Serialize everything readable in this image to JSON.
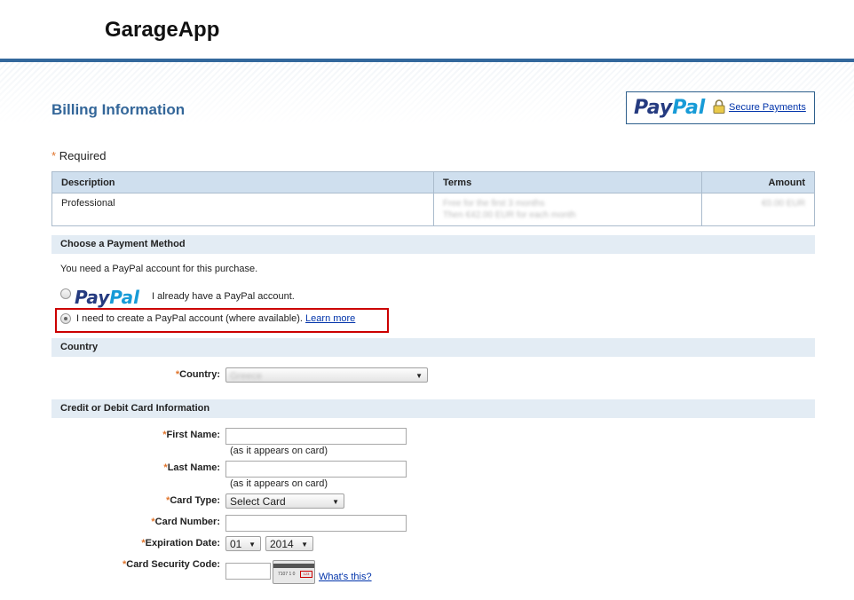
{
  "header": {
    "app_title": "GarageApp"
  },
  "billing": {
    "title": "Billing Information"
  },
  "paypal_badge": {
    "logo_pay": "Pay",
    "logo_pal": "Pal",
    "secure_link": "Secure Payments"
  },
  "required_note": {
    "star": "*",
    "text": "Required"
  },
  "order_table": {
    "headers": {
      "description": "Description",
      "terms": "Terms",
      "amount": "Amount"
    },
    "row": {
      "description": "Professional",
      "terms_line1": "Free for the first 3 months",
      "terms_line2": "Then €42.00 EUR for each month",
      "amount": "€0.00 EUR"
    }
  },
  "payment_method": {
    "section_title": "Choose a Payment Method",
    "note": "You need a PayPal account for this purchase.",
    "option_existing": {
      "logo_pay": "Pay",
      "logo_pal": "Pal",
      "text": "I already have a PayPal account.",
      "selected": false
    },
    "option_create": {
      "text": "I need to create a PayPal account (where available).",
      "learn_more": "Learn more",
      "selected": true
    }
  },
  "country": {
    "section_title": "Country",
    "label": "Country:",
    "value": "Greece"
  },
  "card": {
    "section_title": "Credit or Debit Card Information",
    "first_name_label": "First Name:",
    "first_name_hint": "(as it appears on card)",
    "last_name_label": "Last Name:",
    "last_name_hint": "(as it appears on card)",
    "card_type_label": "Card Type:",
    "card_type_value": "Select Card",
    "card_number_label": "Card Number:",
    "expiration_label": "Expiration Date:",
    "exp_month": "01",
    "exp_year": "2014",
    "security_label": "Card Security Code:",
    "card_image_number": "7107 1 0",
    "card_image_cvv": "123",
    "whats_this": "What's this?"
  },
  "colors": {
    "accent": "#33689c",
    "section_bg": "#e3ecf4",
    "table_header_bg": "#cfdfee",
    "highlight_border": "#cc0000",
    "required_star": "#e0752d"
  }
}
